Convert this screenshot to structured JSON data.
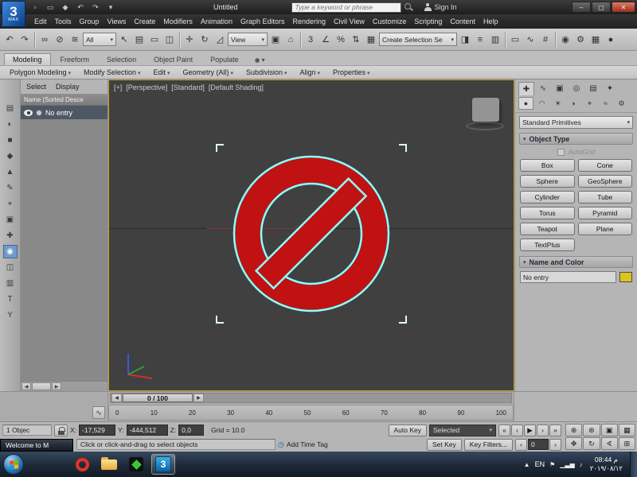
{
  "window": {
    "logo_main": "3",
    "logo_sub": "MAX",
    "title": "Untitled",
    "search_placeholder": "Type a keyword or phrase",
    "sign_in": "Sign In"
  },
  "menubar": {
    "items": [
      "Edit",
      "Tools",
      "Group",
      "Views",
      "Create",
      "Modifiers",
      "Animation",
      "Graph Editors",
      "Rendering",
      "Civil View",
      "Customize",
      "Scripting",
      "Content",
      "Help"
    ]
  },
  "toolbar": {
    "selection_filter": "All",
    "coord_system": "View",
    "named_selection": "Create Selection Se"
  },
  "ribbon": {
    "tabs": [
      "Modeling",
      "Freeform",
      "Selection",
      "Object Paint",
      "Populate"
    ],
    "groups": [
      "Polygon Modeling",
      "Modify Selection",
      "Edit",
      "Geometry (All)",
      "Subdivision",
      "Align",
      "Properties"
    ]
  },
  "scene_explorer": {
    "select_menu": "Select",
    "display_menu": "Display",
    "column_header": "Name (Sorted Desce",
    "object_name": "No entry",
    "tool_icons": [
      "▤",
      "◐",
      "■",
      "◆",
      "▲",
      "✎",
      "⌖",
      "▣",
      "✚",
      "◉",
      "◫",
      "▥",
      "T",
      "Y"
    ]
  },
  "viewport": {
    "menu_plus": "[+]",
    "menu_pov": "[Perspective]",
    "menu_renderer": "[Standard]",
    "menu_shading": "[Default Shading]"
  },
  "time_slider": {
    "value": "0 / 100"
  },
  "track_bar": {
    "ticks": [
      "0",
      "10",
      "20",
      "30",
      "40",
      "50",
      "60",
      "70",
      "80",
      "90",
      "100"
    ]
  },
  "command_panel": {
    "category_dropdown": "Standard Primitives",
    "object_type_title": "Object Type",
    "autogrid_label": "AutoGrid",
    "object_buttons": [
      "Box",
      "Cone",
      "Sphere",
      "GeoSphere",
      "Cylinder",
      "Tube",
      "Torus",
      "Pyramid",
      "Teapot",
      "Plane",
      "TextPlus"
    ],
    "name_color_title": "Name and Color",
    "object_name": "No entry",
    "object_color": "#ddc51c"
  },
  "status_bar": {
    "selection_count": "1 Objec",
    "x_label": "X:",
    "x_value": "-17,529",
    "y_label": "Y:",
    "y_value": "-444,512",
    "z_label": "Z:",
    "z_value": "0,0",
    "grid_info": "Grid = 10.0",
    "prompt": "Click or click-and-drag to select objects",
    "add_time_tag": "Add Time Tag",
    "auto_key": "Auto Key",
    "set_key": "Set Key",
    "key_mode": "Selected",
    "key_filters": "Key Filters...",
    "frame_number": "0",
    "welcome_title": "Welcome to M"
  },
  "taskbar": {
    "language": "EN",
    "time": "08:44 م",
    "date": "٢٠١٩/٠٨/١٢"
  },
  "colors": {
    "viewport_border": "#c7a220",
    "sign_red": "#c01212",
    "selection_outline": "#8fffff",
    "object_swatch": "#ddc51c"
  },
  "icons": {
    "qat_new": "▫",
    "qat_open": "▭",
    "qat_save": "◆",
    "qat_undo": "↶",
    "qat_redo": "↷",
    "qat_arrow": "▾",
    "win_min": "–",
    "win_max": "▢",
    "win_close": "✕",
    "undo": "↶",
    "redo": "↷",
    "link": "∞",
    "unlink": "⊘",
    "bind": "≋",
    "select": "↖",
    "select_by_name": "▤",
    "region": "▭",
    "crossing": "◫",
    "move": "✛",
    "rotate": "↻",
    "scale": "◿",
    "use_center": "▣",
    "placement": "⌂",
    "snap": "3",
    "angle_snap": "∠",
    "percent_snap": "%",
    "spinner_snap": "⇅",
    "edit_selections": "▦",
    "mirror": "◨",
    "align": "≡",
    "layers": "▥",
    "ribbon_toggle": "▭",
    "curve_editor": "∿",
    "schematic": "#",
    "material_editor": "◉",
    "render_setup": "⚙",
    "rendered_frame": "▦",
    "render": "●",
    "ribbon_config": "◉",
    "ribbon_min": "▾",
    "tab_create": "✚",
    "tab_modify": "∿",
    "tab_hierarchy": "▣",
    "tab_motion": "◎",
    "tab_display": "▤",
    "tab_utilities": "✦",
    "cat_geometry": "●",
    "cat_shapes": "◠",
    "cat_lights": "☀",
    "cat_cameras": "◗",
    "cat_helpers": "⌖",
    "cat_spacewarps": "≈",
    "cat_systems": "⚙",
    "ts_prev": "◀",
    "ts_next": "▶",
    "mini_curve": "∿",
    "go_start": "«",
    "prev_frame": "‹",
    "play": "▶",
    "next_frame": "›",
    "go_end": "»",
    "spin_left": "‹",
    "spin_right": "›",
    "zoom": "⊕",
    "zoom_all": "⊛",
    "zoom_extents": "▣",
    "zoom_extents_all": "▦",
    "pan": "✥",
    "orbit": "↻",
    "fov": "∢",
    "maximize_viewport": "⊞",
    "time_tag": "◷",
    "scroll_left": "◀",
    "scroll_right": "▶",
    "collapse": "◀",
    "tray_hidden": "▲",
    "tray_flag": "⚑",
    "tray_network": "▁▃▅",
    "tray_volume": "♪"
  }
}
